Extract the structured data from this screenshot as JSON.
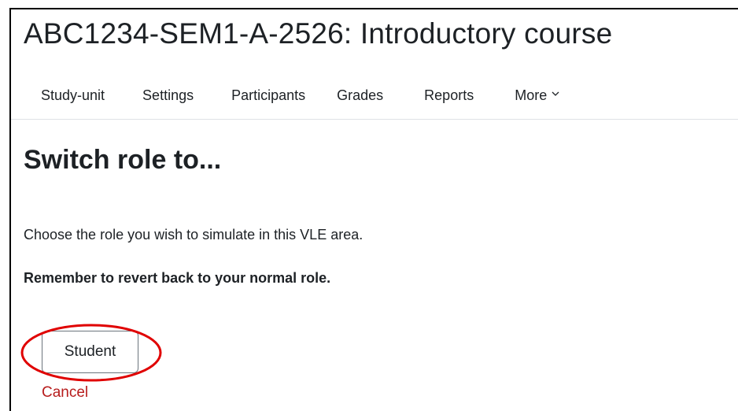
{
  "course": {
    "title": "ABC1234-SEM1-A-2526: Introductory course"
  },
  "nav": {
    "items": [
      {
        "label": "Study-unit"
      },
      {
        "label": "Settings"
      },
      {
        "label": "Participants"
      },
      {
        "label": "Grades"
      },
      {
        "label": "Reports"
      },
      {
        "label": "More"
      }
    ],
    "more_icon": "chevron-down-icon"
  },
  "page": {
    "title": "Switch role to...",
    "intro": "Choose the role you wish to simulate in this VLE area.",
    "reminder": "Remember to revert back to your normal role."
  },
  "roles": {
    "student_label": "Student"
  },
  "actions": {
    "cancel_label": "Cancel"
  },
  "colors": {
    "text": "#1d2125",
    "cancel_link": "#b71c1c",
    "highlight_ellipse": "#e00000",
    "button_border": "#6c757d"
  }
}
